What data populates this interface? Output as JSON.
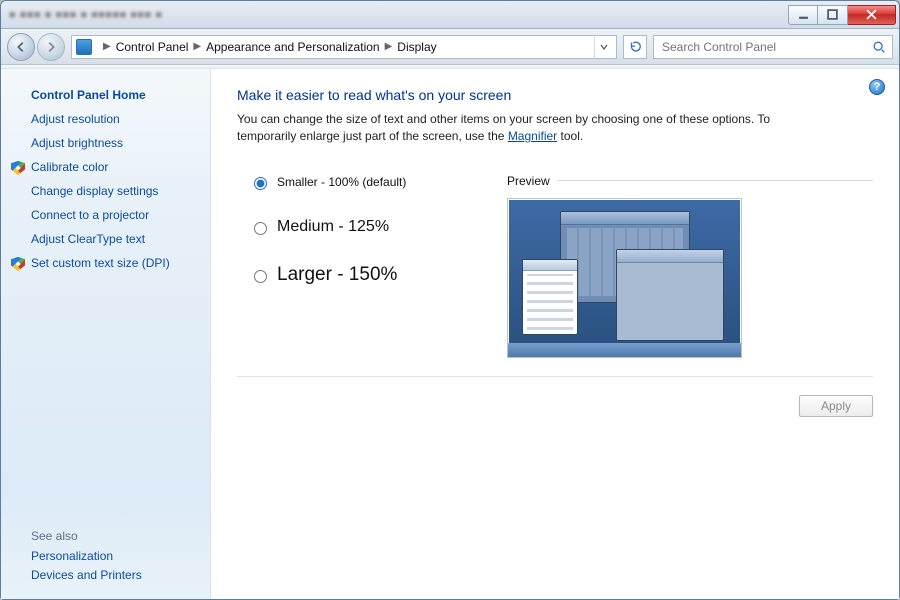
{
  "window_controls": {
    "min": "–",
    "max": "□",
    "close": "✕"
  },
  "breadcrumb": {
    "root_icon": "cp-icon",
    "items": [
      "Control Panel",
      "Appearance and Personalization",
      "Display"
    ]
  },
  "search": {
    "placeholder": "Search Control Panel"
  },
  "sidebar": {
    "home": "Control Panel Home",
    "links": [
      {
        "label": "Adjust resolution",
        "shielded": false
      },
      {
        "label": "Adjust brightness",
        "shielded": false
      },
      {
        "label": "Calibrate color",
        "shielded": true
      },
      {
        "label": "Change display settings",
        "shielded": false
      },
      {
        "label": "Connect to a projector",
        "shielded": false
      },
      {
        "label": "Adjust ClearType text",
        "shielded": false
      },
      {
        "label": "Set custom text size (DPI)",
        "shielded": true
      }
    ],
    "see_also_header": "See also",
    "see_also": [
      "Personalization",
      "Devices and Printers"
    ]
  },
  "main": {
    "title": "Make it easier to read what's on your screen",
    "intro_pre": "You can change the size of text and other items on your screen by choosing one of these options. To temporarily enlarge just part of the screen, use the ",
    "intro_link": "Magnifier",
    "intro_post": " tool.",
    "options": {
      "smaller": "Smaller - 100% (default)",
      "medium": "Medium - 125%",
      "larger": "Larger - 150%",
      "selected": "smaller"
    },
    "preview_label": "Preview",
    "apply_label": "Apply"
  },
  "help_char": "?"
}
